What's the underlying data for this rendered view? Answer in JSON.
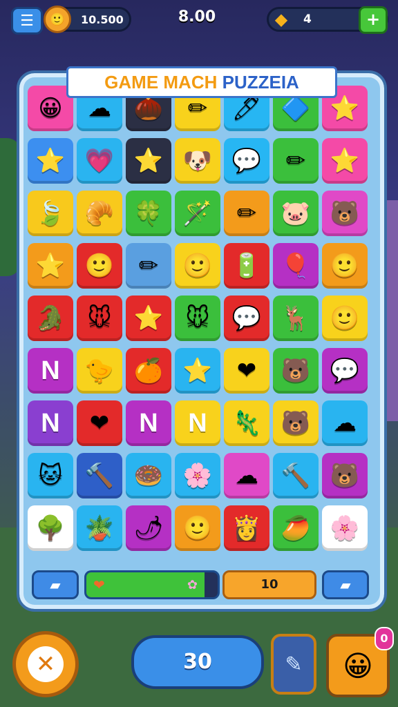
{
  "header": {
    "menu_icon": "hamburger-icon",
    "coins": "10.500",
    "center_value": "8.00",
    "gems": "4",
    "gem_icon": "gem-icon"
  },
  "title": {
    "part1": "GAME MA",
    "part2": "CH ",
    "part3": "PUZZEIA"
  },
  "board": {
    "tiles": [
      {
        "bg": "#f44aa7",
        "g": "😀"
      },
      {
        "bg": "#29b4f0",
        "g": "☁"
      },
      {
        "bg": "#2b2f44",
        "g": "🌰"
      },
      {
        "bg": "#f8d21c",
        "g": "✏"
      },
      {
        "bg": "#27b6f3",
        "g": "🖊"
      },
      {
        "bg": "#3bbf3c",
        "g": "🔷"
      },
      {
        "bg": "#f44aa7",
        "g": "⭐"
      },
      {
        "bg": "#3c8ff0",
        "g": "⭐"
      },
      {
        "bg": "#2ab4f0",
        "g": "💗"
      },
      {
        "bg": "#2b2f44",
        "g": "⭐"
      },
      {
        "bg": "#f8d21c",
        "g": "🐶"
      },
      {
        "bg": "#27b6f3",
        "g": "💬"
      },
      {
        "bg": "#3bbf3c",
        "g": "✏"
      },
      {
        "bg": "#f44aa7",
        "g": "⭐"
      },
      {
        "bg": "#f8c91c",
        "g": "🍃"
      },
      {
        "bg": "#f8c91c",
        "g": "🥐"
      },
      {
        "bg": "#3bbf3c",
        "g": "🍀"
      },
      {
        "bg": "#3bbf3c",
        "g": "🪄"
      },
      {
        "bg": "#f39b1b",
        "g": "✏"
      },
      {
        "bg": "#3bbf3c",
        "g": "🐷"
      },
      {
        "bg": "#e049c7",
        "g": "🐻"
      },
      {
        "bg": "#f39b1b",
        "g": "⭐"
      },
      {
        "bg": "#e32a2a",
        "g": "🙂"
      },
      {
        "bg": "#5a9fe0",
        "g": "✏"
      },
      {
        "bg": "#f8d21c",
        "g": "🙂"
      },
      {
        "bg": "#e32a2a",
        "g": "🔋"
      },
      {
        "bg": "#b530c4",
        "g": "🎈"
      },
      {
        "bg": "#f39b1b",
        "g": "🙂"
      },
      {
        "bg": "#e32a2a",
        "g": "🐊"
      },
      {
        "bg": "#e32a2a",
        "g": "🐭"
      },
      {
        "bg": "#e32a2a",
        "g": "⭐"
      },
      {
        "bg": "#3bbf3c",
        "g": "🐭"
      },
      {
        "bg": "#e32a2a",
        "g": "💬"
      },
      {
        "bg": "#3bbf3c",
        "g": "🦌"
      },
      {
        "bg": "#f8d21c",
        "g": "🙂"
      },
      {
        "bg": "#b530c4",
        "g": "N"
      },
      {
        "bg": "#f8d21c",
        "g": "🐤"
      },
      {
        "bg": "#e32a2a",
        "g": "🍊"
      },
      {
        "bg": "#29b4f0",
        "g": "⭐"
      },
      {
        "bg": "#f8d21c",
        "g": "❤"
      },
      {
        "bg": "#3bbf3c",
        "g": "🐻"
      },
      {
        "bg": "#b530c4",
        "g": "💬"
      },
      {
        "bg": "#8a3fd0",
        "g": "N"
      },
      {
        "bg": "#e32a2a",
        "g": "❤"
      },
      {
        "bg": "#b530c4",
        "g": "N"
      },
      {
        "bg": "#f8d21c",
        "g": "N"
      },
      {
        "bg": "#f8d21c",
        "g": "🦎"
      },
      {
        "bg": "#f8d21c",
        "g": "🐻"
      },
      {
        "bg": "#29b4f0",
        "g": "☁"
      },
      {
        "bg": "#29b4f0",
        "g": "🐱"
      },
      {
        "bg": "#2e5fc8",
        "g": "🔨"
      },
      {
        "bg": "#29b4f0",
        "g": "🍩"
      },
      {
        "bg": "#29b4f0",
        "g": "🌸"
      },
      {
        "bg": "#e049c7",
        "g": "☁"
      },
      {
        "bg": "#29b4f0",
        "g": "🔨"
      },
      {
        "bg": "#b530c4",
        "g": "🐻"
      },
      {
        "bg": "#ffffff",
        "g": "🌳"
      },
      {
        "bg": "#29b4f0",
        "g": "🪴"
      },
      {
        "bg": "#b530c4",
        "g": "🌶"
      },
      {
        "bg": "#f39b1b",
        "g": "🙂"
      },
      {
        "bg": "#e32a2a",
        "g": "👸"
      },
      {
        "bg": "#3bbf3c",
        "g": "🥭"
      },
      {
        "bg": "#ffffff",
        "g": "🌸"
      }
    ]
  },
  "board_footer": {
    "left_icon": "eraser-icon",
    "progress_heart": "heart-icon",
    "progress_end": "flower-icon",
    "progress_fraction": 0.9,
    "score": "10",
    "right_icon": "eraser-icon"
  },
  "footer": {
    "close_icon": "close-icon",
    "moves": "30",
    "tool_icon": "pencil-icon",
    "face_icon": "smiley-icon",
    "badge": "0"
  }
}
